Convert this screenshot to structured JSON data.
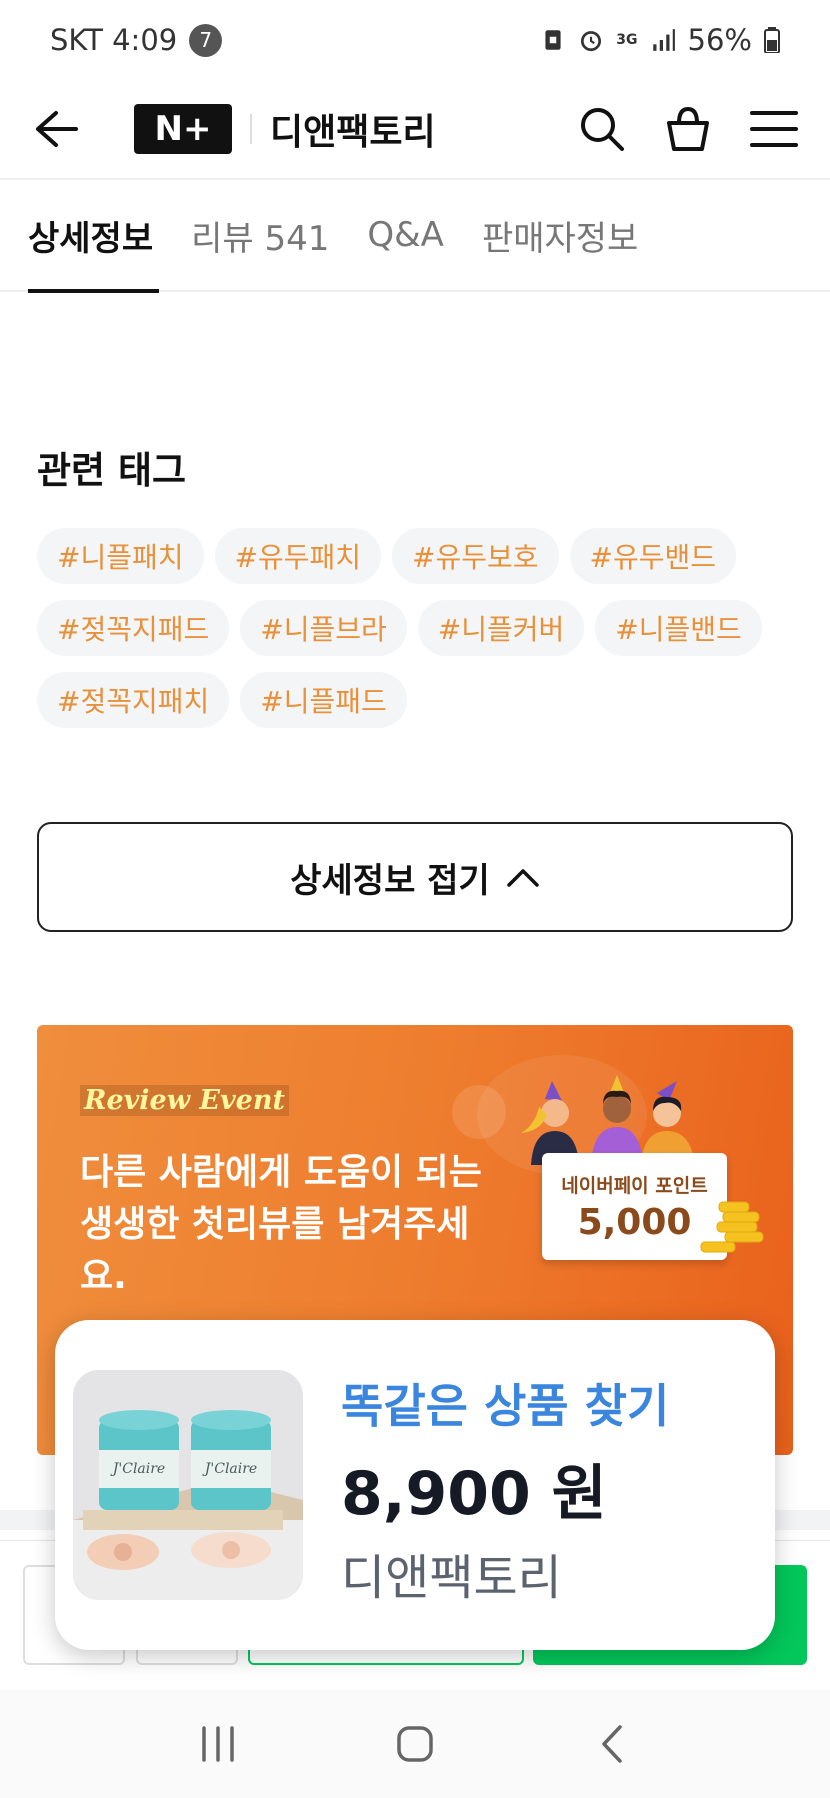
{
  "status_bar": {
    "carrier_time": "SKT 4:09",
    "notification_count": "7",
    "network": "3G",
    "battery": "56%"
  },
  "header": {
    "logo_text": "N+",
    "shop_name": "디앤팩토리"
  },
  "tabs": [
    {
      "label": "상세정보"
    },
    {
      "label": "리뷰 541"
    },
    {
      "label": "Q&A"
    },
    {
      "label": "판매자정보"
    }
  ],
  "related_tags": {
    "title": "관련 태그",
    "tags": [
      "#니플패치",
      "#유두패치",
      "#유두보호",
      "#유두밴드",
      "#젖꼭지패드",
      "#니플브라",
      "#니플커버",
      "#니플밴드",
      "#젖꼭지패치",
      "#니플패드"
    ]
  },
  "fold_button": {
    "label": "상세정보 접기"
  },
  "review_banner": {
    "event_label": "Review Event",
    "message_line1": "다른 사람에게 도움이 되는",
    "message_line2": "생생한 첫리뷰를 남겨주세",
    "message_line3": "요.",
    "point_label": "네이버페이 포인트",
    "point_value": "5,000"
  },
  "popup": {
    "title": "똑같은 상품 찾기",
    "price": "8,900 원",
    "shop": "디앤팩토리",
    "product_brand": "J'Claire"
  },
  "colors": {
    "tag_text": "#e8913a",
    "banner_orange": "#ee7d2e",
    "popup_title": "#3a86de",
    "naver_green": "#03c75a"
  }
}
